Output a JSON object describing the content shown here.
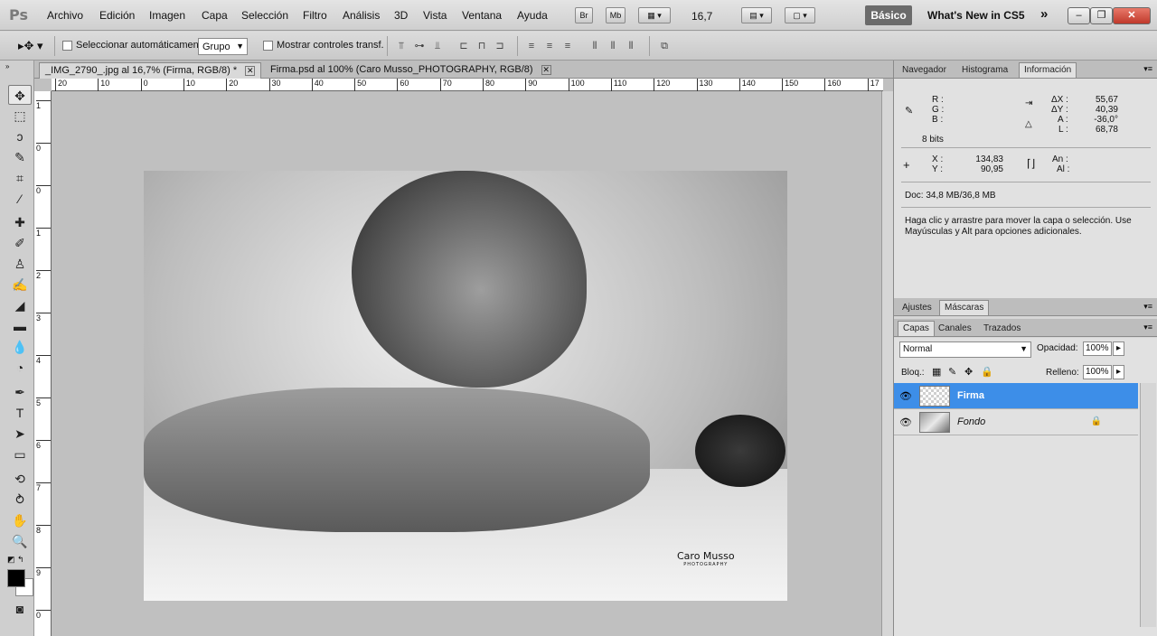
{
  "app": {
    "logo": "Ps"
  },
  "menu": [
    "Archivo",
    "Edición",
    "Imagen",
    "Capa",
    "Selección",
    "Filtro",
    "Análisis",
    "3D",
    "Vista",
    "Ventana",
    "Ayuda"
  ],
  "appbar": {
    "br": "Br",
    "mb": "Mb",
    "zoom": "16,7",
    "workspace": "Básico",
    "whats_new": "What's New in CS5",
    "more": "»"
  },
  "options": {
    "auto_select_label": "Seleccionar automáticamente:",
    "auto_select_value": "Grupo",
    "transform_label": "Mostrar controles transf."
  },
  "doc_tabs": [
    {
      "label": "_IMG_2790_.jpg al 16,7% (Firma, RGB/8) *",
      "active": true
    },
    {
      "label": "Firma.psd al 100% (Caro Musso_PHOTOGRAPHY, RGB/8)",
      "active": false
    }
  ],
  "ruler": {
    "h_ticks": [
      "20",
      "10",
      "0",
      "10",
      "20",
      "30",
      "40",
      "50",
      "60",
      "70",
      "80",
      "90",
      "100",
      "110",
      "120",
      "130",
      "140",
      "150",
      "160",
      "17"
    ],
    "v_ticks": [
      "1",
      "0",
      "0",
      "1",
      "2",
      "3",
      "4",
      "5",
      "6",
      "7",
      "8",
      "9",
      "0"
    ]
  },
  "canvas": {
    "watermark_line1": "Caro Musso",
    "watermark_line2": "PHOTOGRAPHY"
  },
  "panel_top": {
    "tabs": [
      "Navegador",
      "Histograma",
      "Información"
    ]
  },
  "info": {
    "rgb": {
      "r": "R :",
      "g": "G :",
      "b": "B :"
    },
    "bits": "8 bits",
    "delta": {
      "dx_label": "ΔX :",
      "dx": "55,67",
      "dy_label": "ΔY :",
      "dy": "40,39",
      "a_label": "A :",
      "a": "-36,0°",
      "l_label": "L :",
      "l": "68,78"
    },
    "xy": {
      "x_label": "X :",
      "x": "134,83",
      "y_label": "Y :",
      "y": "90,95"
    },
    "size": {
      "an_label": "An :",
      "al_label": "Al :"
    },
    "doc": "Doc: 34,8 MB/36,8 MB",
    "hint": "Haga clic y arrastre para mover la capa o selección. Use Mayúsculas y Alt para opciones adicionales."
  },
  "panel_mid": {
    "tabs": [
      "Ajustes",
      "Máscaras"
    ]
  },
  "panel_layers": {
    "tabs": [
      "Capas",
      "Canales",
      "Trazados"
    ],
    "blend": "Normal",
    "opacity_label": "Opacidad:",
    "opacity": "100%",
    "lock_label": "Bloq.:",
    "fill_label": "Relleno:",
    "fill": "100%",
    "layers": [
      {
        "name": "Firma",
        "selected": true
      },
      {
        "name": "Fondo",
        "selected": false
      }
    ]
  }
}
